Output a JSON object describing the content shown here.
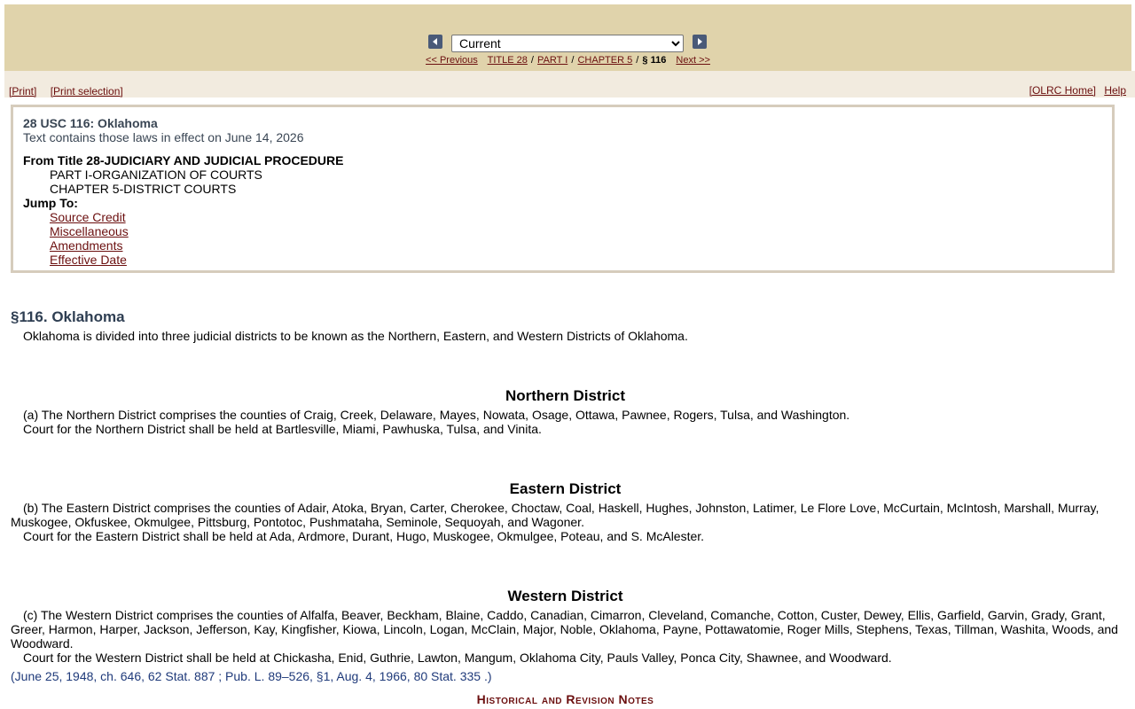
{
  "nav": {
    "edition": "Current",
    "crumbs": {
      "previous": "<< Previous",
      "title": "TITLE 28",
      "part": "PART I",
      "chapter": "CHAPTER 5",
      "current": "§ 116",
      "next": "Next >>"
    }
  },
  "toolbar": {
    "print": "[Print]",
    "print_selection": "[Print selection]",
    "olrc_home": "[OLRC Home]",
    "help": "Help"
  },
  "infobox": {
    "title": "28 USC 116: Oklahoma",
    "effect": "Text contains those laws in effect on June 14, 2026",
    "from": "From Title 28-JUDICIARY AND JUDICIAL PROCEDURE",
    "part": "PART I-ORGANIZATION OF COURTS",
    "chapter": "CHAPTER 5-DISTRICT COURTS",
    "jump_to": "Jump To:",
    "links": [
      "Source Credit",
      "Miscellaneous",
      "Amendments",
      "Effective Date"
    ]
  },
  "section": {
    "heading": "§116. Oklahoma",
    "intro": "Oklahoma is divided into three judicial districts to be known as the Northern, Eastern, and Western Districts of Oklahoma.",
    "northern": {
      "heading": "Northern District",
      "a": "(a) The Northern District comprises the counties of Craig, Creek, Delaware, Mayes, Nowata, Osage, Ottawa, Pawnee, Rogers, Tulsa, and Washington.",
      "court": "Court for the Northern District shall be held at Bartlesville, Miami, Pawhuska, Tulsa, and Vinita."
    },
    "eastern": {
      "heading": "Eastern District",
      "b": "(b) The Eastern District comprises the counties of Adair, Atoka, Bryan, Carter, Cherokee, Choctaw, Coal, Haskell, Hughes, Johnston, Latimer, Le Flore Love, McCurtain, McIntosh, Marshall, Murray, Muskogee, Okfuskee, Okmulgee, Pittsburg, Pontotoc, Pushmataha, Seminole, Sequoyah, and Wagoner.",
      "court": "Court for the Eastern District shall be held at Ada, Ardmore, Durant, Hugo, Muskogee, Okmulgee, Poteau, and S. McAlester."
    },
    "western": {
      "heading": "Western District",
      "c": "(c) The Western District comprises the counties of Alfalfa, Beaver, Beckham, Blaine, Caddo, Canadian, Cimarron, Cleveland, Comanche, Cotton, Custer, Dewey, Ellis, Garfield, Garvin, Grady, Grant, Greer, Harmon, Harper, Jackson, Jefferson, Kay, Kingfisher, Kiowa, Lincoln, Logan, McClain, Major, Noble, Oklahoma, Payne, Pottawatomie, Roger Mills, Stephens, Texas, Tillman, Washita, Woods, and Woodward.",
      "court": "Court for the Western District shall be held at Chickasha, Enid, Guthrie, Lawton, Mangum, Oklahoma City, Pauls Valley, Ponca City, Shawnee, and Woodward."
    },
    "citation": "(June 25, 1948, ch. 646, 62 Stat. 887 ; Pub. L. 89–526, §1, Aug. 4, 1966, 80 Stat. 335 .)",
    "notes_heading": "Historical and Revision Notes"
  }
}
